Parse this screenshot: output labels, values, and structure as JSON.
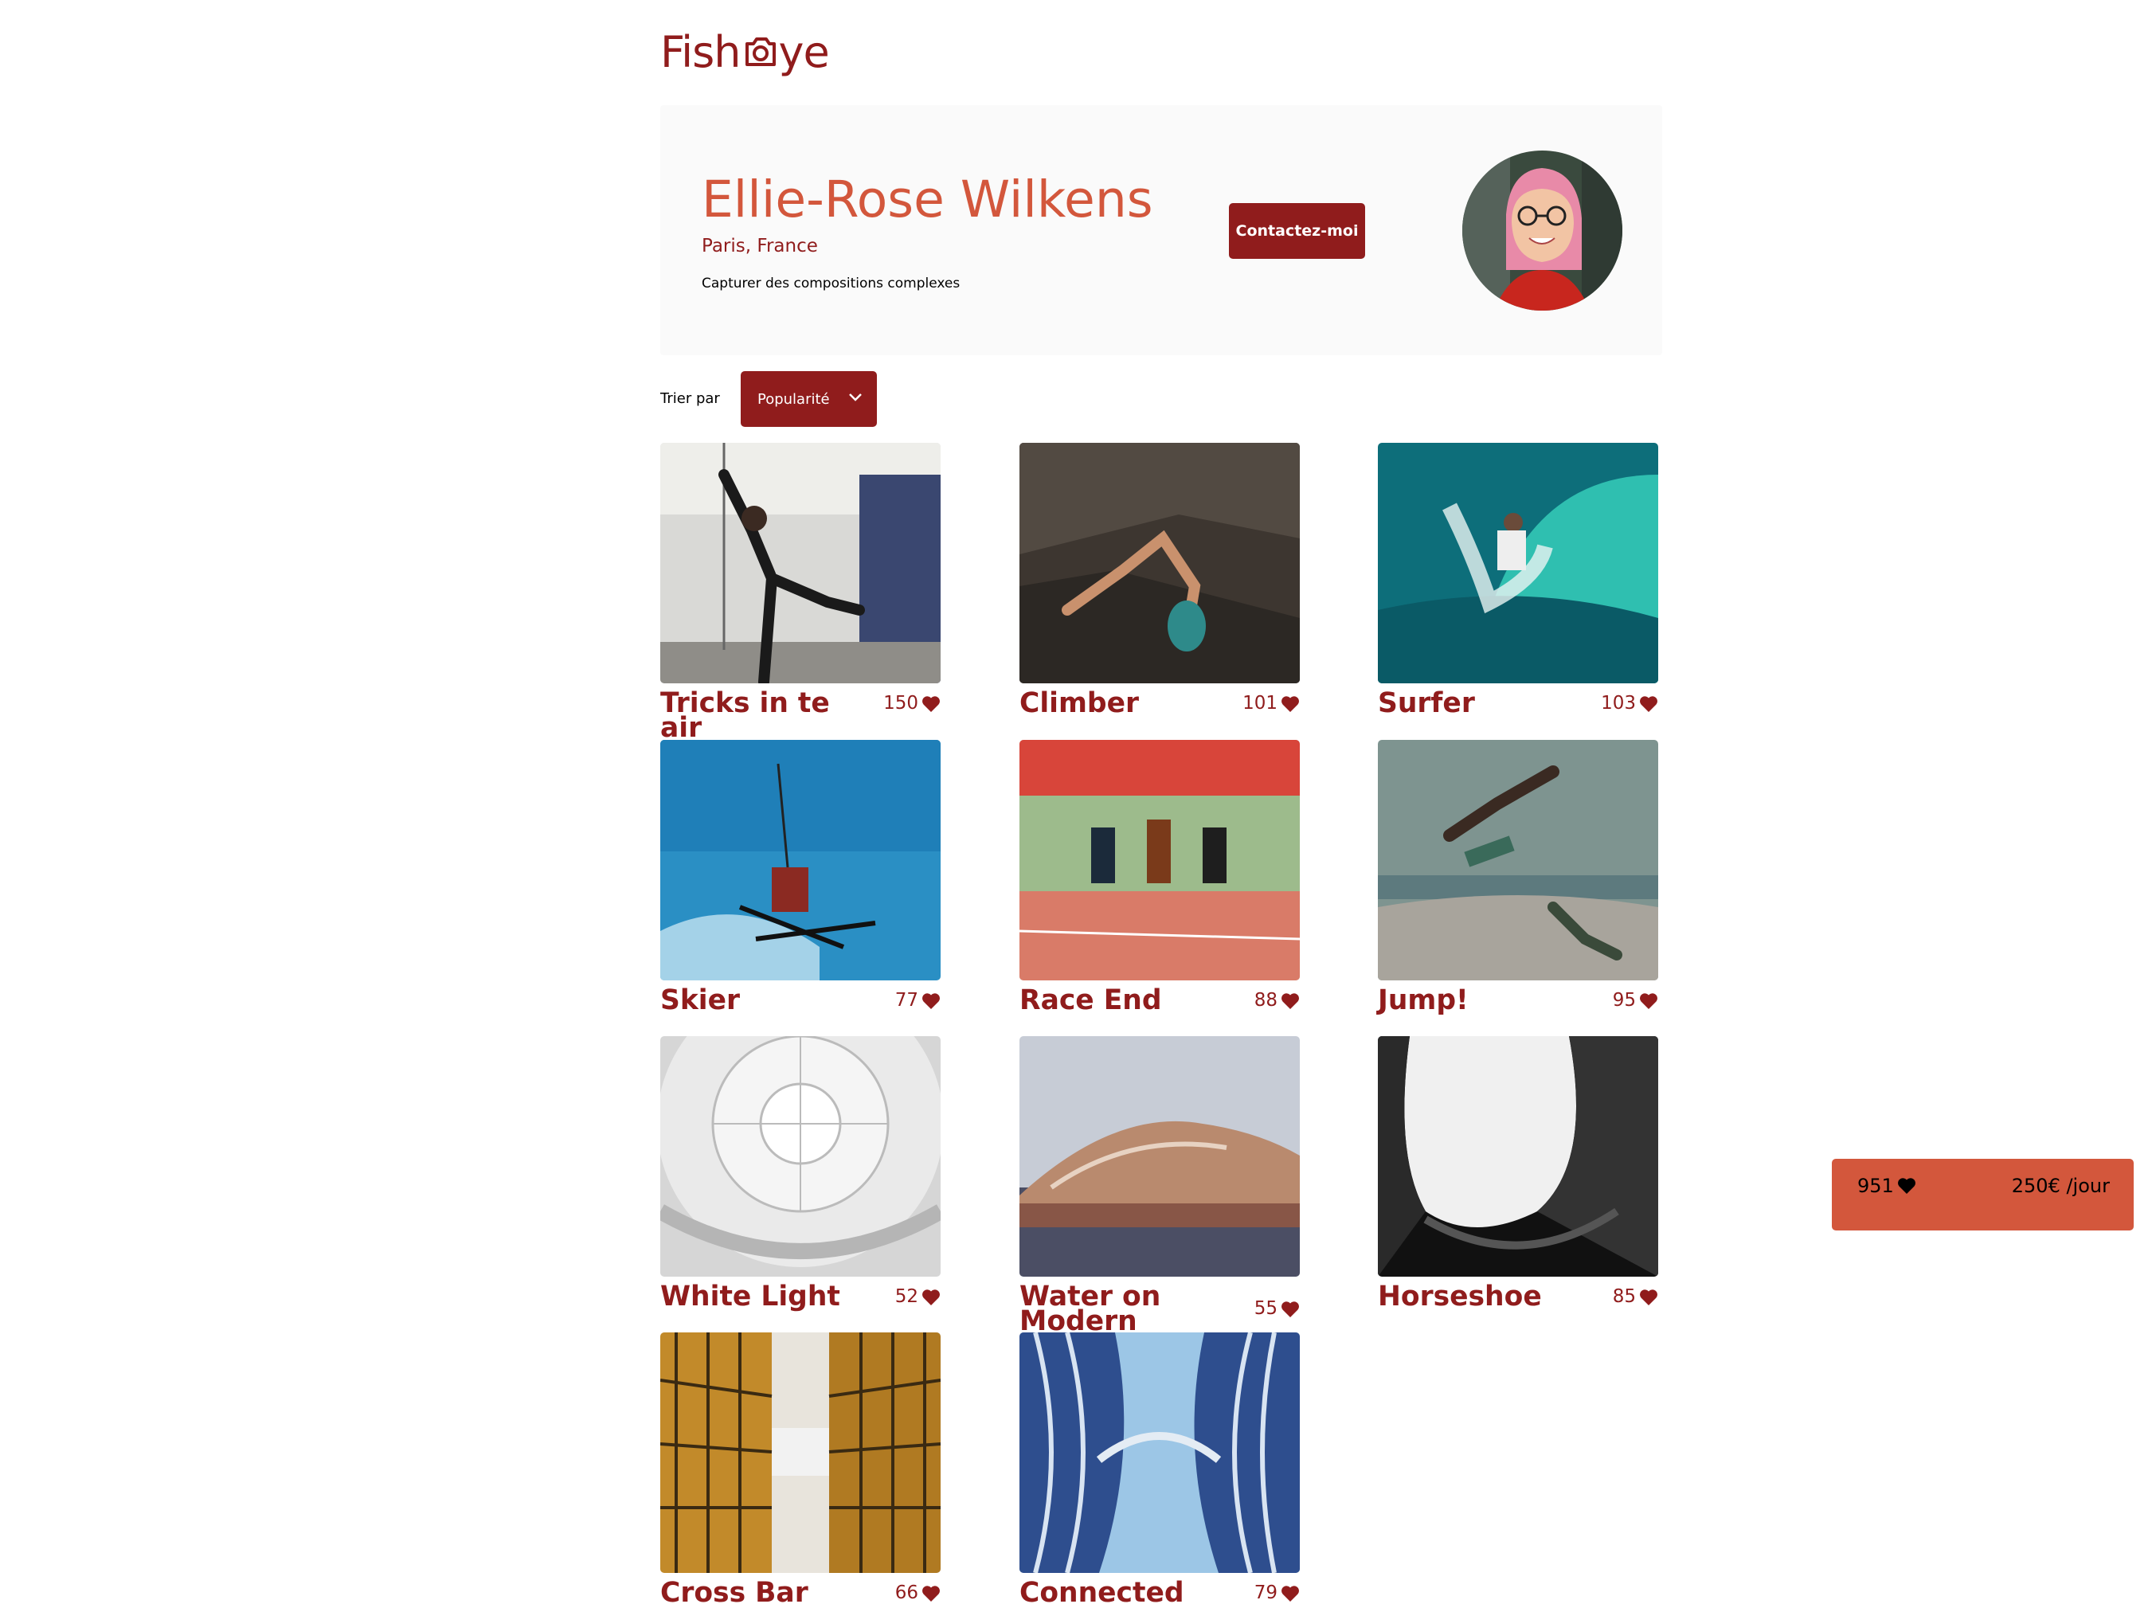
{
  "logo": {
    "text_before": "Fish",
    "text_after": "ye",
    "icon": "camera-icon"
  },
  "photographer": {
    "name": "Ellie-Rose Wilkens",
    "location": "Paris, France",
    "tagline": "Capturer des compositions complexes"
  },
  "contact_button": "Contactez-moi",
  "sort": {
    "label": "Trier par",
    "selected": "Popularité",
    "icon": "chevron-down-icon"
  },
  "media": [
    {
      "title": "Tricks in te air",
      "likes": "150"
    },
    {
      "title": "Climber",
      "likes": "101"
    },
    {
      "title": "Surfer",
      "likes": "103"
    },
    {
      "title": "Skier",
      "likes": "77"
    },
    {
      "title": "Race End",
      "likes": "88"
    },
    {
      "title": "Jump!",
      "likes": "95"
    },
    {
      "title": "White Light",
      "likes": "52"
    },
    {
      "title": "Water on Modern Building",
      "likes": "55"
    },
    {
      "title": "Horseshoe",
      "likes": "85"
    },
    {
      "title": "Cross Bar",
      "likes": "66"
    },
    {
      "title": "Connected Curves",
      "likes": "79"
    }
  ],
  "stats": {
    "total_likes": "951",
    "price": "250€ /jour"
  },
  "colors": {
    "primary": "#901C1C",
    "secondary": "#D3573C",
    "header_bg": "#FAFAFA"
  }
}
